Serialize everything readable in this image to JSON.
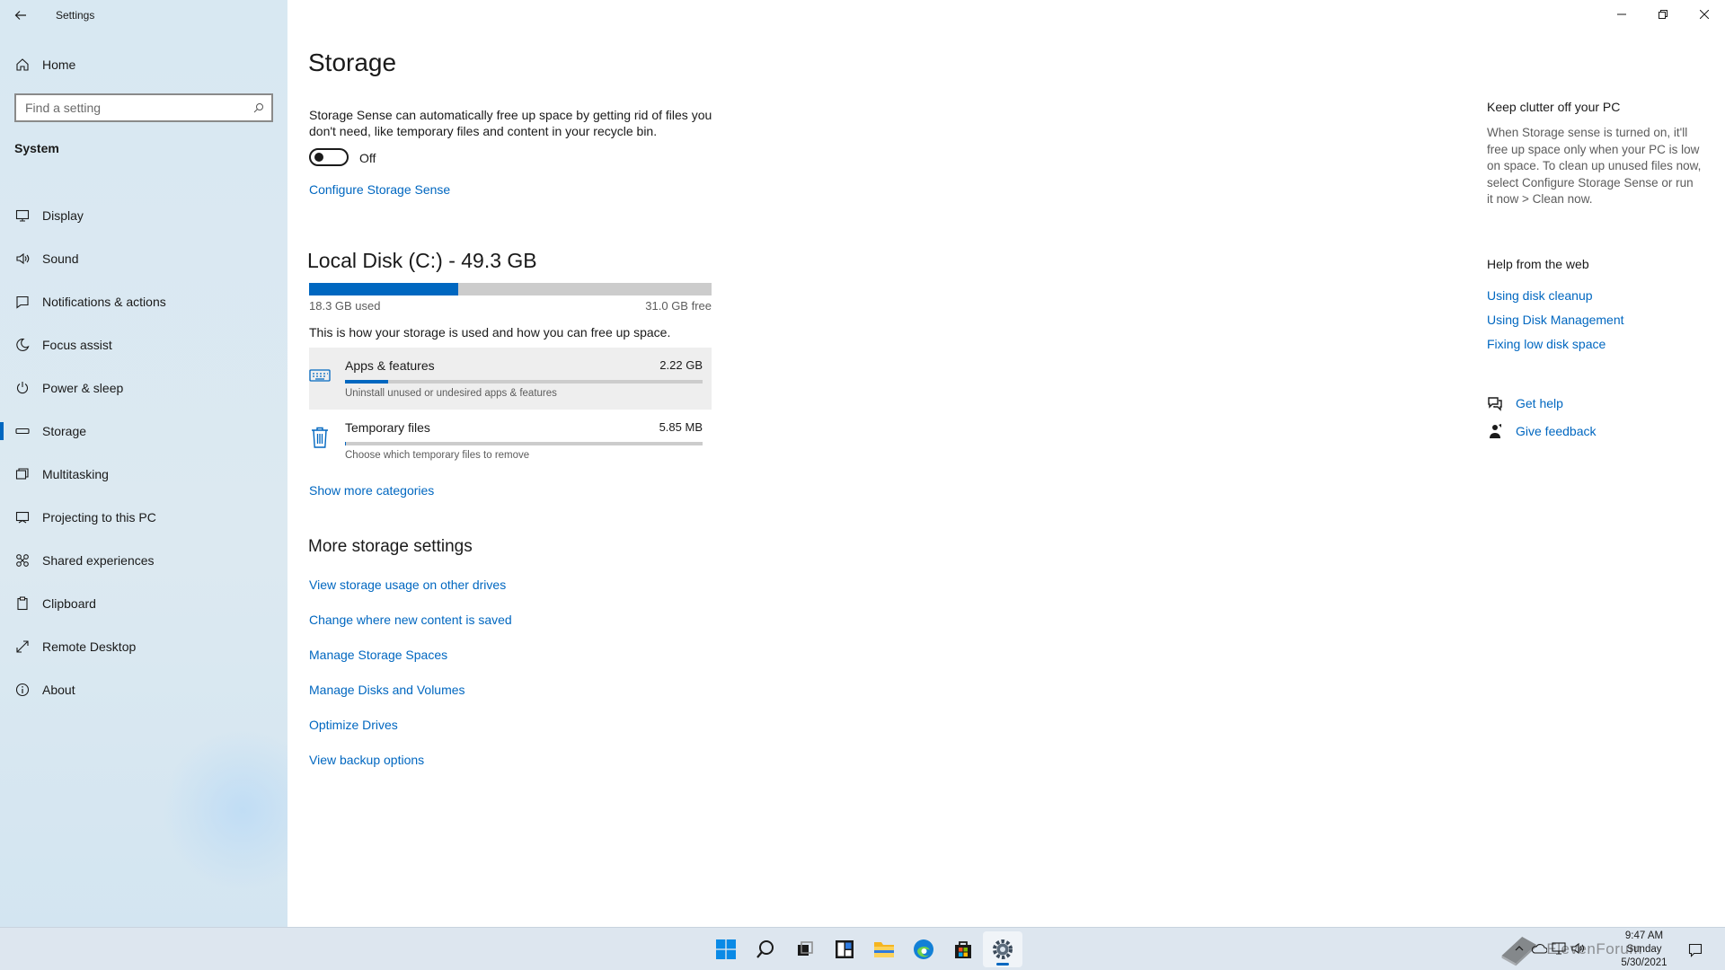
{
  "window": {
    "title": "Settings",
    "controls": {
      "minimize": "minimize-icon",
      "restore": "restore-icon",
      "close": "close-icon"
    }
  },
  "sidebar": {
    "home_label": "Home",
    "search_placeholder": "Find a setting",
    "section": "System",
    "items": [
      {
        "label": "Display",
        "icon": "monitor-icon"
      },
      {
        "label": "Sound",
        "icon": "speaker-icon"
      },
      {
        "label": "Notifications & actions",
        "icon": "notification-icon"
      },
      {
        "label": "Focus assist",
        "icon": "moon-icon"
      },
      {
        "label": "Power & sleep",
        "icon": "power-icon"
      },
      {
        "label": "Storage",
        "icon": "drive-icon",
        "active": true
      },
      {
        "label": "Multitasking",
        "icon": "multitasking-icon"
      },
      {
        "label": "Projecting to this PC",
        "icon": "projector-icon"
      },
      {
        "label": "Shared experiences",
        "icon": "shared-icon"
      },
      {
        "label": "Clipboard",
        "icon": "clipboard-icon"
      },
      {
        "label": "Remote Desktop",
        "icon": "remote-icon"
      },
      {
        "label": "About",
        "icon": "info-icon"
      }
    ]
  },
  "main": {
    "title": "Storage",
    "storage_sense_desc": "Storage Sense can automatically free up space by getting rid of files you don't need, like temporary files and content in your recycle bin.",
    "toggle_state": "Off",
    "configure_link": "Configure Storage Sense",
    "disk": {
      "title": "Local Disk (C:) - 49.3 GB",
      "used": "18.3 GB used",
      "free": "31.0 GB free",
      "used_fraction": 0.371
    },
    "how_text": "This is how your storage is used and how you can free up space.",
    "categories": [
      {
        "name": "Apps & features",
        "size": "2.22 GB",
        "desc": "Uninstall unused or undesired apps & features",
        "fraction": 0.12,
        "icon": "keyboard-icon"
      },
      {
        "name": "Temporary files",
        "size": "5.85 MB",
        "desc": "Choose which temporary files to remove",
        "fraction": 0.002,
        "icon": "trash-icon"
      }
    ],
    "show_more": "Show more categories",
    "more_title": "More storage settings",
    "more_links": [
      "View storage usage on other drives",
      "Change where new content is saved",
      "Manage Storage Spaces",
      "Manage Disks and Volumes",
      "Optimize Drives",
      "View backup options"
    ]
  },
  "right": {
    "title": "Keep clutter off your PC",
    "desc": "When Storage sense is turned on, it'll free up space only when your PC is low on space. To clean up unused files now, select Configure Storage Sense or run it now > Clean now.",
    "web_title": "Help from the web",
    "web_links": [
      "Using disk cleanup",
      "Using Disk Management",
      "Fixing low disk space"
    ],
    "get_help": "Get help",
    "feedback": "Give feedback"
  },
  "taskbar": {
    "icons": [
      "windows-start-icon",
      "search-icon",
      "task-view-icon",
      "widgets-icon",
      "file-explorer-icon",
      "edge-icon",
      "store-icon",
      "settings-icon"
    ],
    "time": "9:47 AM",
    "day": "Sunday",
    "date": "5/30/2021",
    "watermark": "ElevenForum"
  },
  "colors": {
    "accent": "#0067c0",
    "sidebar_bg": "#d8e8f2",
    "taskbar_bg": "#dde6ef"
  }
}
